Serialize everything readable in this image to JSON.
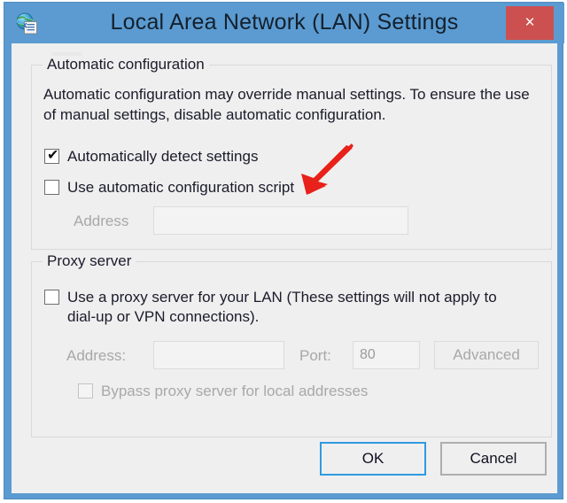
{
  "window": {
    "title": "Local Area Network (LAN) Settings",
    "icon": "globe-settings-icon",
    "close_label": "×",
    "frame_color": "#5b9bd1",
    "client_color": "#efefef",
    "close_button_color": "#cd5050"
  },
  "automatic_configuration": {
    "legend": "Automatic configuration",
    "description": "Automatic configuration may override manual settings.  To ensure the use of manual settings, disable automatic configuration.",
    "detect_settings": {
      "label": "Automatically detect settings",
      "checked": true,
      "enabled": true
    },
    "use_script": {
      "label": "Use automatic configuration script",
      "checked": false,
      "enabled": true
    },
    "address": {
      "label": "Address",
      "value": "",
      "enabled": false
    }
  },
  "proxy_server": {
    "legend": "Proxy server",
    "use_proxy": {
      "label": "Use a proxy server for your LAN (These settings will not apply to\ndial-up or VPN connections).",
      "checked": false,
      "enabled": true
    },
    "address": {
      "label": "Address:",
      "value": "",
      "enabled": false
    },
    "port": {
      "label": "Port:",
      "value": "80",
      "enabled": false
    },
    "advanced_button": {
      "label": "Advanced",
      "enabled": false
    },
    "bypass": {
      "label": "Bypass proxy server for local addresses",
      "checked": false,
      "enabled": false
    }
  },
  "footer": {
    "ok_label": "OK",
    "cancel_label": "Cancel"
  },
  "annotation": {
    "arrow_color": "#e8211a",
    "points_to": "Automatically detect settings"
  }
}
